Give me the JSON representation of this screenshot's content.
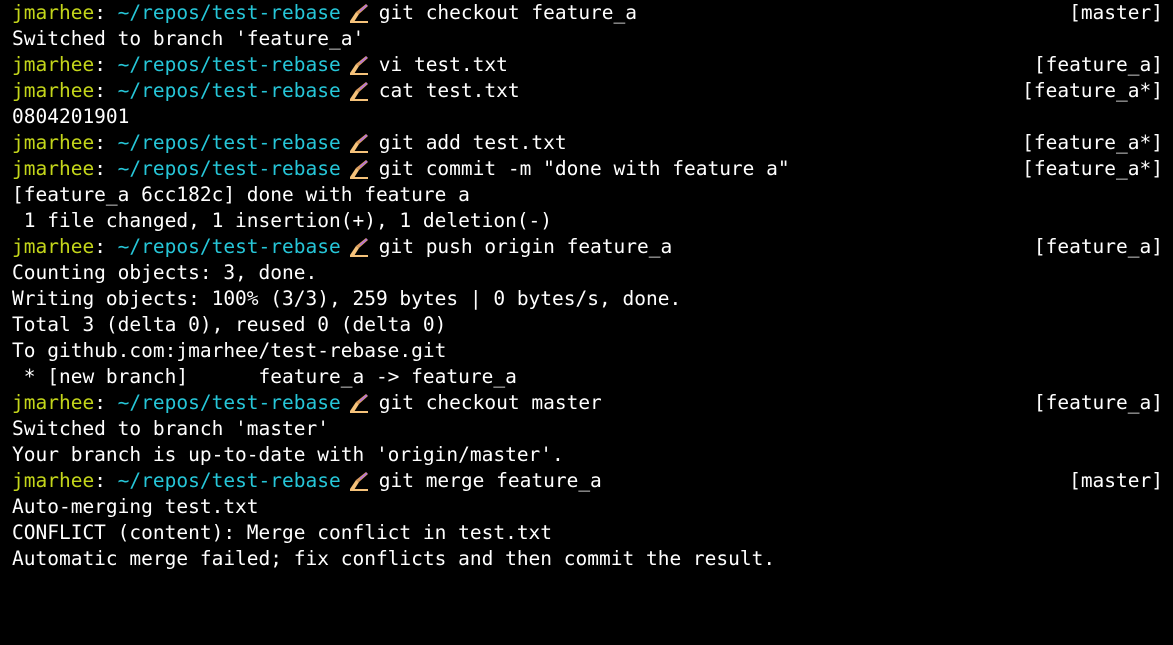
{
  "terminal": {
    "lines": [
      {
        "type": "prompt",
        "user": "jmarhee",
        "sep": ": ",
        "path": "~/repos/test-rebase",
        "cmd": "git checkout feature_a",
        "status": "[master]"
      },
      {
        "type": "output",
        "text": "Switched to branch 'feature_a'"
      },
      {
        "type": "prompt",
        "user": "jmarhee",
        "sep": ": ",
        "path": "~/repos/test-rebase",
        "cmd": "vi test.txt",
        "status": "[feature_a]"
      },
      {
        "type": "prompt",
        "user": "jmarhee",
        "sep": ": ",
        "path": "~/repos/test-rebase",
        "cmd": "cat test.txt",
        "status": "[feature_a*]"
      },
      {
        "type": "output",
        "text": "0804201901"
      },
      {
        "type": "prompt",
        "user": "jmarhee",
        "sep": ": ",
        "path": "~/repos/test-rebase",
        "cmd": "git add test.txt",
        "status": "[feature_a*]"
      },
      {
        "type": "prompt",
        "user": "jmarhee",
        "sep": ": ",
        "path": "~/repos/test-rebase",
        "cmd": "git commit -m \"done with feature a\"",
        "status": "[feature_a*]"
      },
      {
        "type": "output",
        "text": "[feature_a 6cc182c] done with feature a"
      },
      {
        "type": "output",
        "text": " 1 file changed, 1 insertion(+), 1 deletion(-)"
      },
      {
        "type": "prompt",
        "user": "jmarhee",
        "sep": ": ",
        "path": "~/repos/test-rebase",
        "cmd": "git push origin feature_a",
        "status": "[feature_a]"
      },
      {
        "type": "output",
        "text": "Counting objects: 3, done."
      },
      {
        "type": "output",
        "text": "Writing objects: 100% (3/3), 259 bytes | 0 bytes/s, done."
      },
      {
        "type": "output",
        "text": "Total 3 (delta 0), reused 0 (delta 0)"
      },
      {
        "type": "output",
        "text": "To github.com:jmarhee/test-rebase.git"
      },
      {
        "type": "output",
        "text": " * [new branch]      feature_a -> feature_a"
      },
      {
        "type": "prompt",
        "user": "jmarhee",
        "sep": ": ",
        "path": "~/repos/test-rebase",
        "cmd": "git checkout master",
        "status": "[feature_a]"
      },
      {
        "type": "output",
        "text": "Switched to branch 'master'"
      },
      {
        "type": "output",
        "text": "Your branch is up-to-date with 'origin/master'."
      },
      {
        "type": "prompt",
        "user": "jmarhee",
        "sep": ": ",
        "path": "~/repos/test-rebase",
        "cmd": "git merge feature_a",
        "status": "[master]"
      },
      {
        "type": "output",
        "text": "Auto-merging test.txt"
      },
      {
        "type": "output",
        "text": "CONFLICT (content): Merge conflict in test.txt"
      },
      {
        "type": "output",
        "text": "Automatic merge failed; fix conflicts and then commit the result."
      }
    ],
    "prompt_icon": "writing-hand-icon",
    "colors": {
      "background": "#000000",
      "text": "#ffffff",
      "user": "#c4d61a",
      "path": "#26c6d8"
    }
  }
}
